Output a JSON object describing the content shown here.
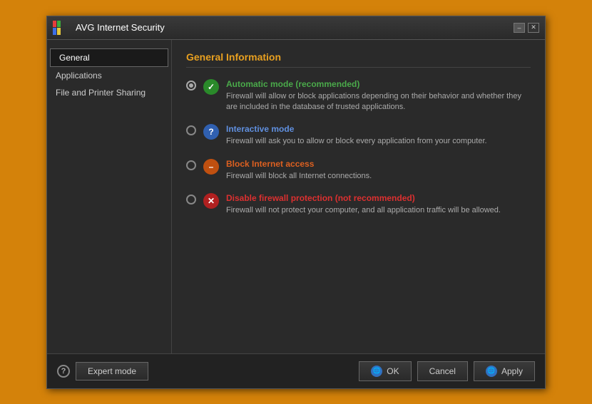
{
  "window": {
    "title": "AVG Internet Security",
    "min_btn": "–",
    "close_btn": "✕"
  },
  "sidebar": {
    "items": [
      {
        "id": "general",
        "label": "General",
        "active": true
      },
      {
        "id": "applications",
        "label": "Applications",
        "active": false
      },
      {
        "id": "file-printer",
        "label": "File and Printer Sharing",
        "active": false
      }
    ]
  },
  "main": {
    "section_title": "General Information",
    "options": [
      {
        "id": "automatic",
        "checked": true,
        "icon_type": "green",
        "icon_symbol": "✓",
        "label": "Automatic mode (recommended)",
        "label_color": "green",
        "description": "Firewall will allow or block applications depending on their behavior and whether they are included in the database of trusted applications."
      },
      {
        "id": "interactive",
        "checked": false,
        "icon_type": "blue",
        "icon_symbol": "?",
        "label": "Interactive mode",
        "label_color": "blue",
        "description": "Firewall will ask you to allow or block every application from your computer."
      },
      {
        "id": "block",
        "checked": false,
        "icon_type": "orange",
        "icon_symbol": "–",
        "label": "Block Internet access",
        "label_color": "orange",
        "description": "Firewall will block all Internet connections."
      },
      {
        "id": "disable",
        "checked": false,
        "icon_type": "red",
        "icon_symbol": "✕",
        "label": "Disable firewall protection (not recommended)",
        "label_color": "red",
        "description": "Firewall will not protect your computer, and all application traffic will be allowed."
      }
    ]
  },
  "footer": {
    "help_symbol": "?",
    "expert_mode_label": "Expert mode",
    "ok_label": "OK",
    "cancel_label": "Cancel",
    "apply_label": "Apply"
  }
}
